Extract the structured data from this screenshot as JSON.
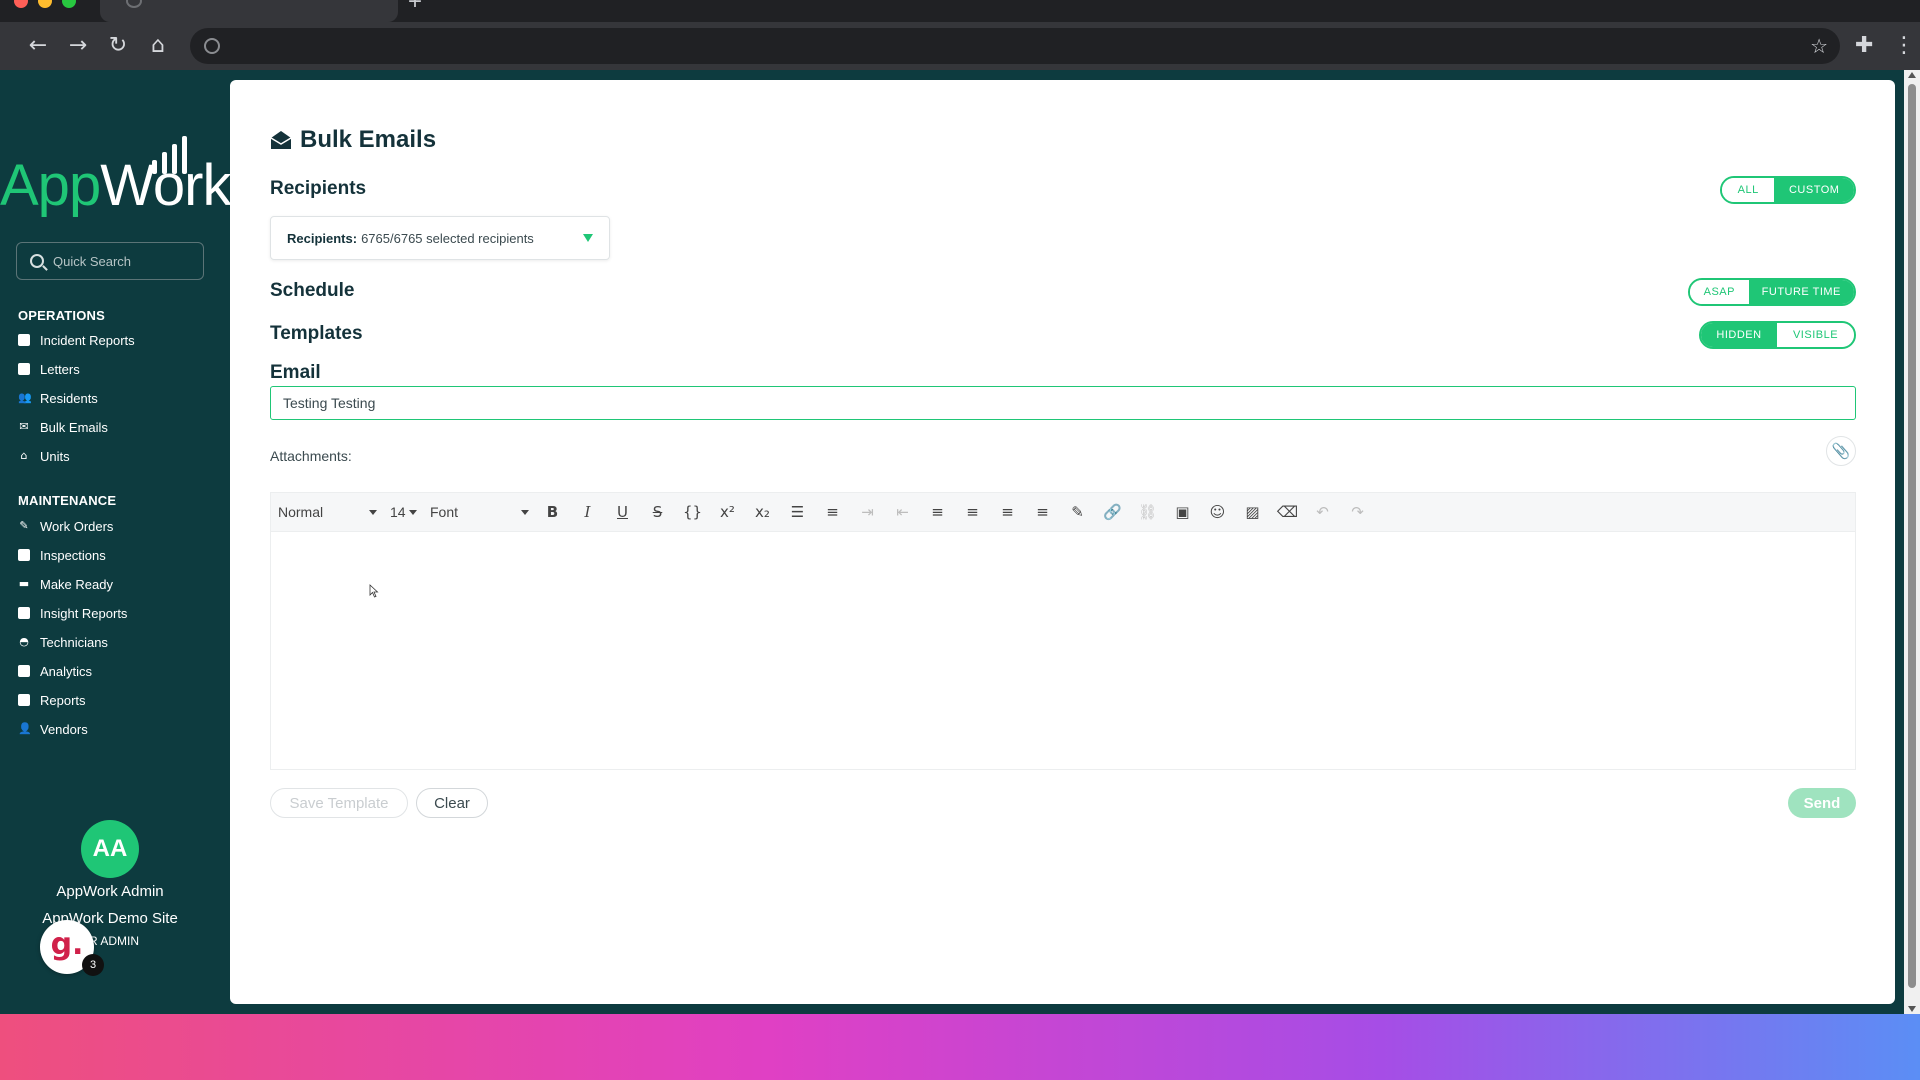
{
  "browser": {
    "traffic_colors": [
      "#ff5f57",
      "#febc2e",
      "#28c840"
    ],
    "new_tab_label": "+",
    "back_icon": "←",
    "forward_icon": "→",
    "reload_icon": "↻",
    "home_icon": "⌂",
    "star_icon": "☆",
    "extensions_icon": "✚",
    "menu_icon": "⋮"
  },
  "sidebar": {
    "logo_app": "App",
    "logo_work": "Work",
    "search_placeholder": "Quick Search",
    "sections": [
      {
        "title": "OPERATIONS",
        "items": [
          {
            "label": "Incident Reports",
            "icon": "document-icon"
          },
          {
            "label": "Letters",
            "icon": "document-icon"
          },
          {
            "label": "Residents",
            "icon": "people-icon"
          },
          {
            "label": "Bulk Emails",
            "icon": "envelope-icon"
          },
          {
            "label": "Units",
            "icon": "home-icon"
          }
        ]
      },
      {
        "title": "MAINTENANCE",
        "items": [
          {
            "label": "Work Orders",
            "icon": "wrench-icon"
          },
          {
            "label": "Inspections",
            "icon": "document-icon"
          },
          {
            "label": "Make Ready",
            "icon": "paint-icon"
          },
          {
            "label": "Insight Reports",
            "icon": "document-icon"
          },
          {
            "label": "Technicians",
            "icon": "helmet-icon"
          },
          {
            "label": "Analytics",
            "icon": "chart-icon"
          },
          {
            "label": "Reports",
            "icon": "document-icon"
          },
          {
            "label": "Vendors",
            "icon": "person-icon"
          }
        ]
      }
    ],
    "user": {
      "initials": "AA",
      "name": "AppWork Admin",
      "site": "AppWork Demo Site",
      "role": "ER ADMIN"
    },
    "badge": {
      "letter": "g.",
      "count": "3"
    }
  },
  "main": {
    "title": "Bulk Emails",
    "recipients": {
      "heading": "Recipients",
      "toggle": {
        "option_a": "ALL",
        "option_b": "CUSTOM",
        "selected": "CUSTOM"
      },
      "select_label": "Recipients:",
      "select_value": "6765/6765 selected recipients"
    },
    "schedule": {
      "heading": "Schedule",
      "toggle": {
        "option_a": "ASAP",
        "option_b": "FUTURE TIME",
        "selected": "FUTURE TIME"
      }
    },
    "templates": {
      "heading": "Templates",
      "toggle": {
        "option_a": "HIDDEN",
        "option_b": "VISIBLE",
        "selected": "HIDDEN"
      }
    },
    "email": {
      "heading": "Email",
      "subject_value": "Testing Testing"
    },
    "attachments_label": "Attachments:",
    "editor": {
      "style_select": "Normal",
      "size_select": "14",
      "font_select": "Font",
      "buttons": [
        {
          "name": "bold-button",
          "glyph": "B"
        },
        {
          "name": "italic-button",
          "glyph": "I"
        },
        {
          "name": "underline-button",
          "glyph": "U"
        },
        {
          "name": "strikethrough-button",
          "glyph": "S"
        },
        {
          "name": "code-button",
          "glyph": "{}"
        },
        {
          "name": "superscript-button",
          "glyph": "x²"
        },
        {
          "name": "subscript-button",
          "glyph": "x₂"
        },
        {
          "name": "bullet-list-button",
          "glyph": "☰"
        },
        {
          "name": "ordered-list-button",
          "glyph": "≡"
        },
        {
          "name": "indent-button",
          "glyph": "⇥"
        },
        {
          "name": "outdent-button",
          "glyph": "⇤"
        },
        {
          "name": "align-left-button",
          "glyph": "≡"
        },
        {
          "name": "align-center-button",
          "glyph": "≡"
        },
        {
          "name": "align-right-button",
          "glyph": "≡"
        },
        {
          "name": "justify-button",
          "glyph": "≡"
        },
        {
          "name": "color-button",
          "glyph": "✎"
        },
        {
          "name": "link-button",
          "glyph": "🔗"
        },
        {
          "name": "unlink-button",
          "glyph": "⛓"
        },
        {
          "name": "embed-button",
          "glyph": "▣"
        },
        {
          "name": "emoji-button",
          "glyph": "☺"
        },
        {
          "name": "image-button",
          "glyph": "▨"
        },
        {
          "name": "eraser-button",
          "glyph": "⌫"
        },
        {
          "name": "undo-button",
          "glyph": "↶"
        },
        {
          "name": "redo-button",
          "glyph": "↷"
        }
      ]
    },
    "actions": {
      "save_template": "Save Template",
      "clear": "Clear",
      "send": "Send"
    }
  },
  "colors": {
    "brand_green": "#1fc676",
    "sidebar_bg": "#0d3b3f",
    "title_text": "#14323a"
  }
}
